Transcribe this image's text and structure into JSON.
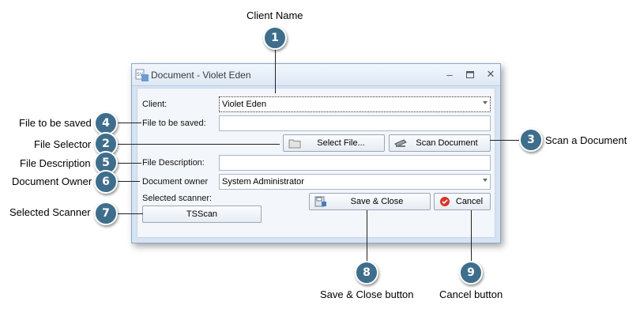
{
  "dialog": {
    "title": "Document - Violet Eden",
    "client_label": "Client:",
    "client_value": "Violet Eden",
    "file_label": "File to be saved:",
    "file_value": "",
    "select_file_label": "Select File...",
    "scan_document_label": "Scan Document",
    "description_label": "File Description:",
    "description_value": "",
    "owner_label": "Document owner",
    "owner_value": "System Administrator",
    "selected_scanner_label": "Selected scanner:",
    "scanner_value": "TSScan",
    "save_close_label": "Save & Close",
    "cancel_label": "Cancel"
  },
  "callouts": [
    {
      "num": "1",
      "text": "Client Name"
    },
    {
      "num": "2",
      "text": "File Selector"
    },
    {
      "num": "3",
      "text": "Scan a Document"
    },
    {
      "num": "4",
      "text": "File to be saved"
    },
    {
      "num": "5",
      "text": "File Description"
    },
    {
      "num": "6",
      "text": "Document Owner"
    },
    {
      "num": "7",
      "text": "Selected Scanner"
    },
    {
      "num": "8",
      "text": "Save & Close button"
    },
    {
      "num": "9",
      "text": "Cancel button"
    }
  ],
  "colors": {
    "badge": "#3f6e8c",
    "dialog_frame": "#d6e3f2"
  }
}
